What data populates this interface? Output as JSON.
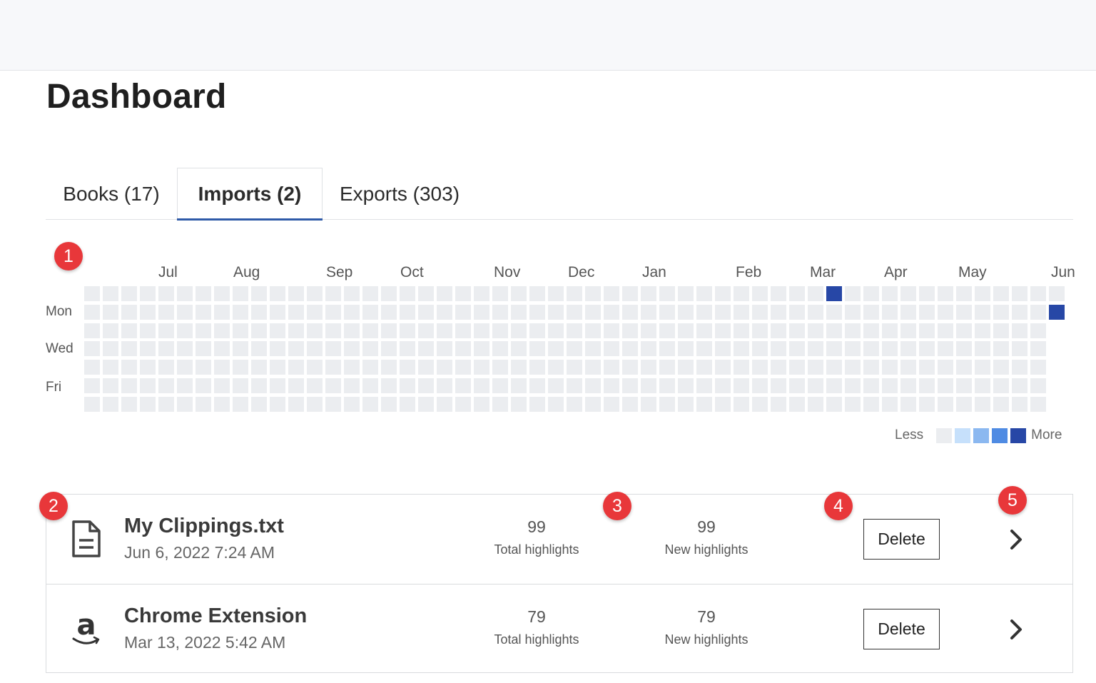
{
  "page": {
    "title": "Dashboard"
  },
  "tabs": [
    {
      "label": "Books (17)",
      "active": false
    },
    {
      "label": "Imports (2)",
      "active": true
    },
    {
      "label": "Exports (303)",
      "active": false
    }
  ],
  "heatmap": {
    "months": [
      "Jul",
      "Aug",
      "Sep",
      "Oct",
      "Nov",
      "Dec",
      "Jan",
      "Feb",
      "Mar",
      "Apr",
      "May",
      "Jun"
    ],
    "days": [
      "Mon",
      "Wed",
      "Fri"
    ],
    "weeks": 53,
    "active_cells": [
      {
        "week": 40,
        "day": 0,
        "level": 4
      },
      {
        "week": 52,
        "day": 1,
        "level": 4
      }
    ],
    "legend": {
      "less": "Less",
      "more": "More"
    },
    "colors": [
      "#ebedf0",
      "#c6e0fb",
      "#8bb8f0",
      "#4f8be3",
      "#2747a6"
    ]
  },
  "annotations": [
    "1",
    "2",
    "3",
    "4",
    "5"
  ],
  "imports": [
    {
      "name": "My Clippings.txt",
      "date": "Jun 6, 2022 7:24 AM",
      "icon": "document-icon",
      "total_highlights": "99",
      "total_label": "Total highlights",
      "new_highlights": "99",
      "new_label": "New highlights",
      "delete_label": "Delete"
    },
    {
      "name": "Chrome Extension",
      "date": "Mar 13, 2022 5:42 AM",
      "icon": "amazon-icon",
      "total_highlights": "79",
      "total_label": "Total highlights",
      "new_highlights": "79",
      "new_label": "New highlights",
      "delete_label": "Delete"
    }
  ],
  "colors": {
    "accent": "#2f5aa8",
    "badge": "#e8373a"
  }
}
